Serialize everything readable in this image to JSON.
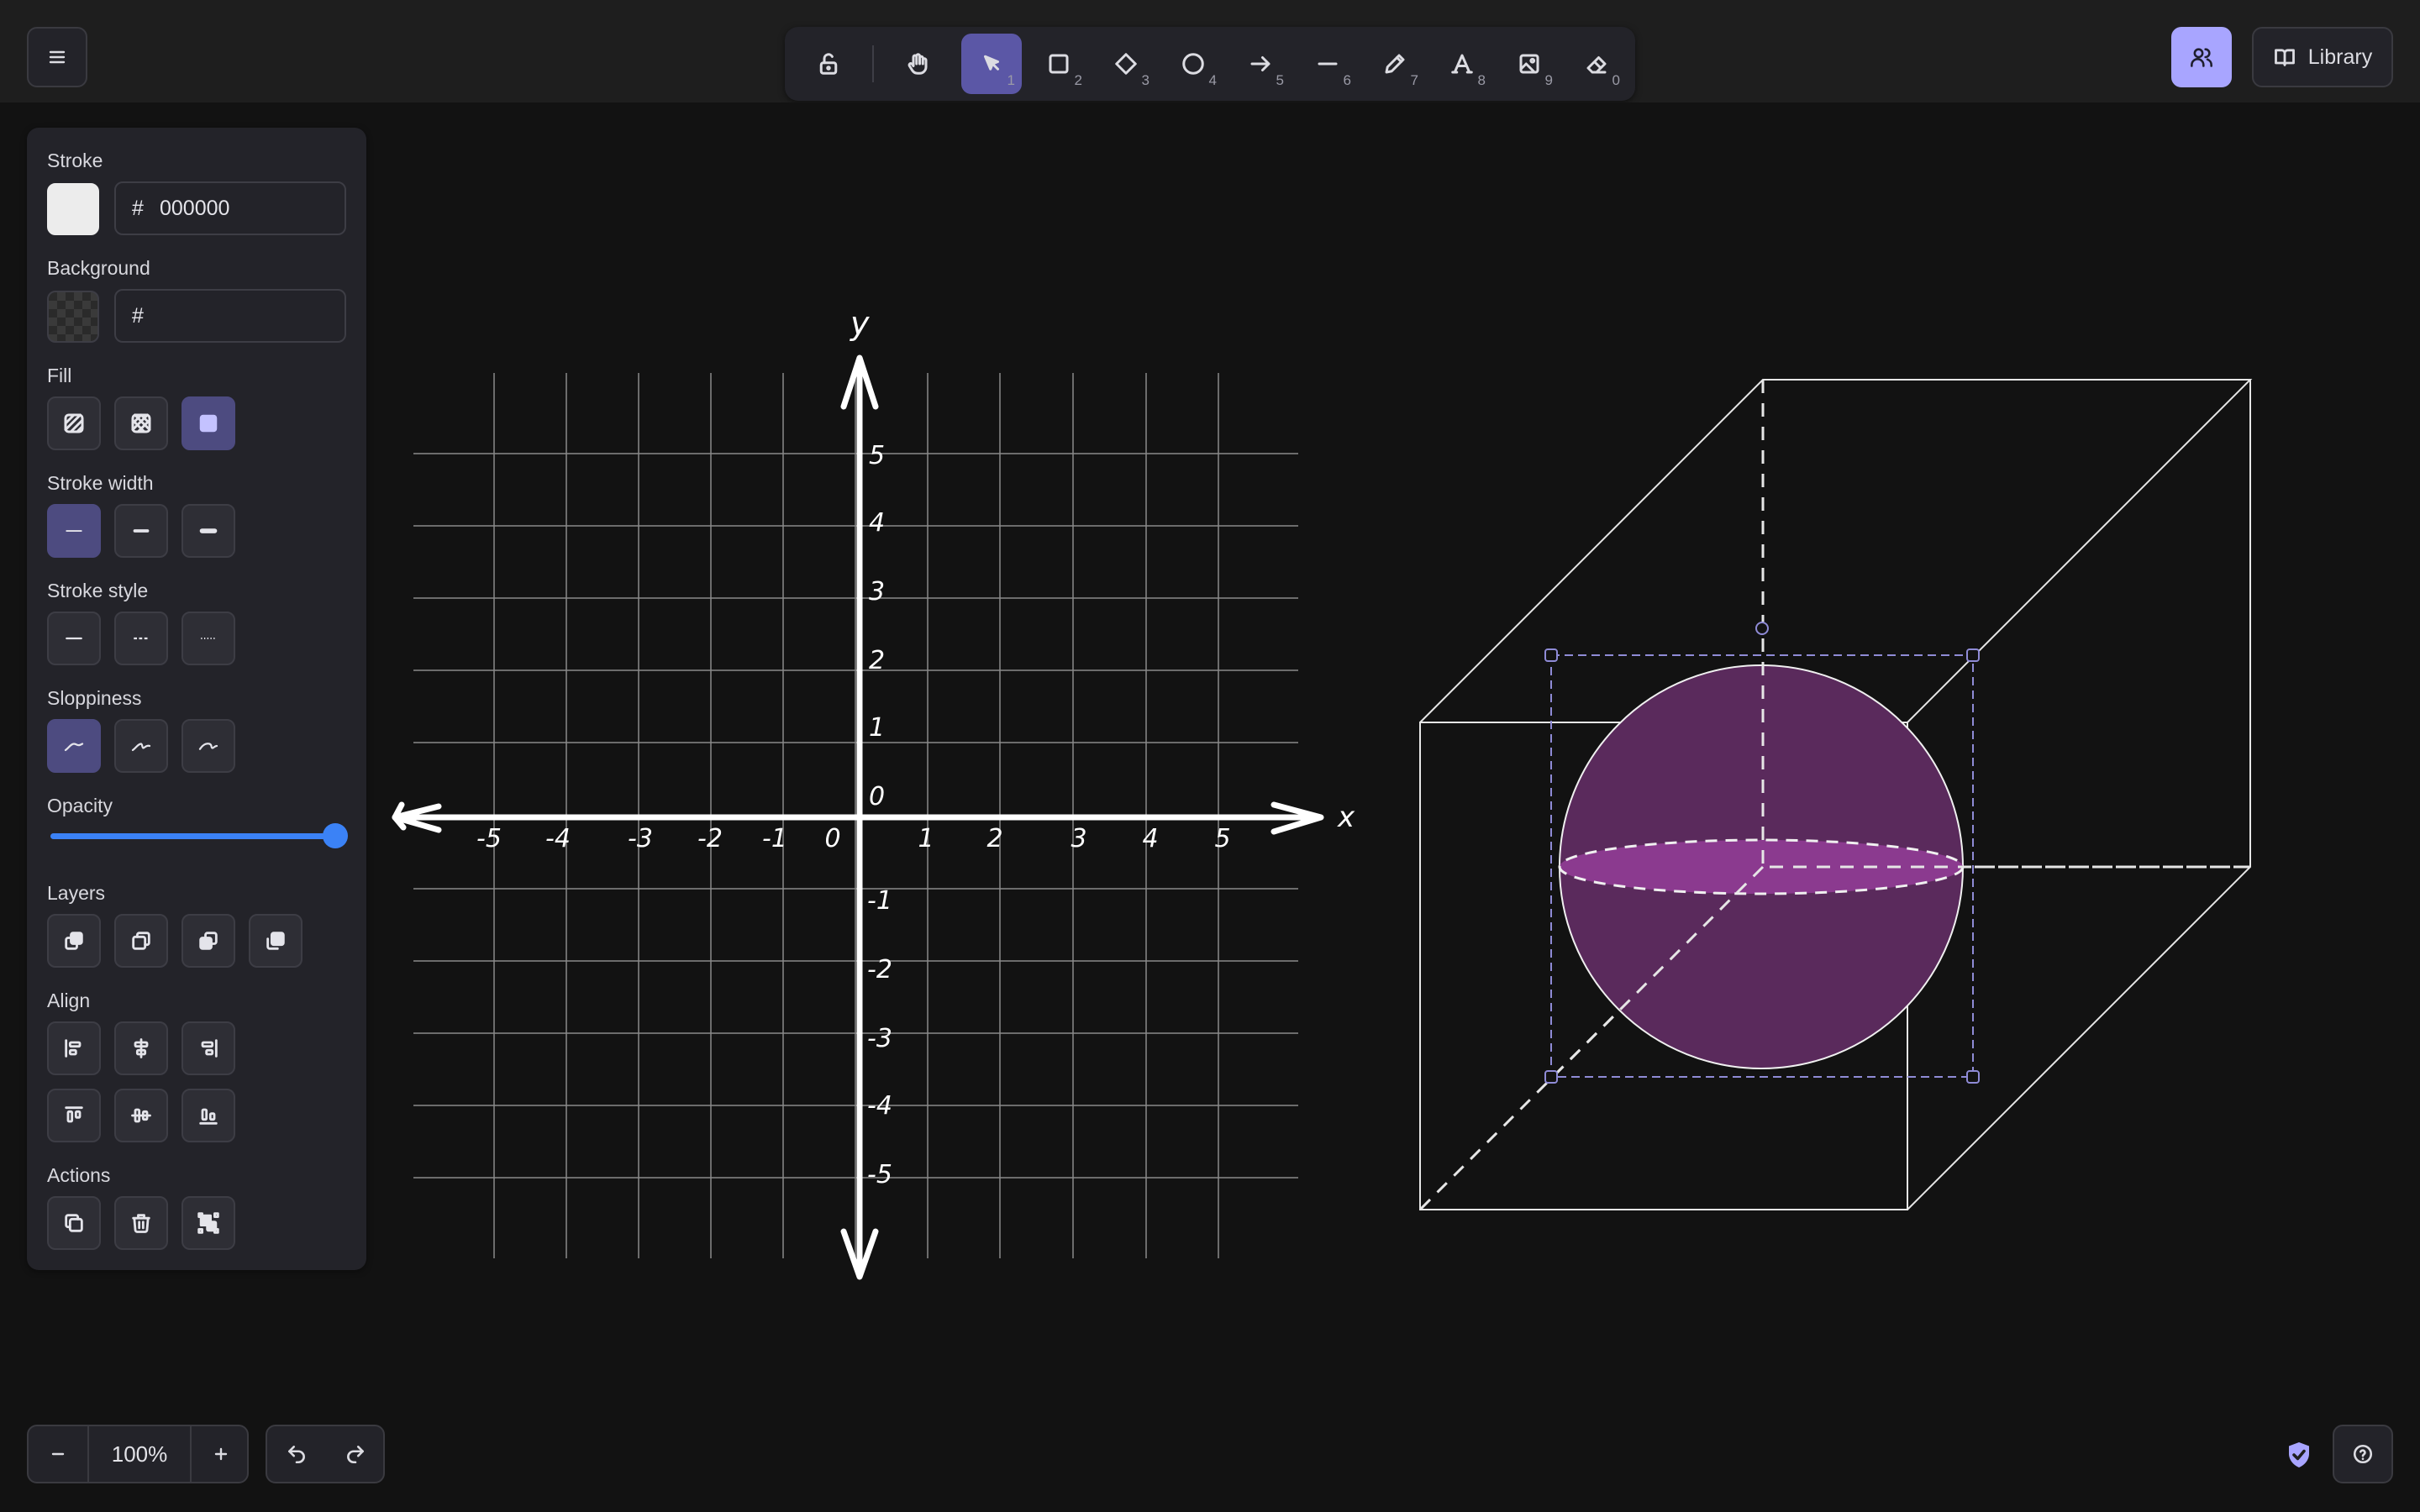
{
  "topbar": {
    "library_label": "Library",
    "tools": [
      {
        "name": "lock",
        "key": ""
      },
      {
        "name": "hand",
        "key": ""
      },
      {
        "name": "selection",
        "key": "1"
      },
      {
        "name": "rectangle",
        "key": "2"
      },
      {
        "name": "diamond",
        "key": "3"
      },
      {
        "name": "ellipse",
        "key": "4"
      },
      {
        "name": "arrow",
        "key": "5"
      },
      {
        "name": "line",
        "key": "6"
      },
      {
        "name": "draw",
        "key": "7"
      },
      {
        "name": "text",
        "key": "8"
      },
      {
        "name": "image",
        "key": "9"
      },
      {
        "name": "eraser",
        "key": "0"
      }
    ],
    "active_tool": "selection"
  },
  "panel": {
    "stroke_label": "Stroke",
    "stroke_hex": "000000",
    "background_label": "Background",
    "background_hex": "",
    "hash": "#",
    "fill_label": "Fill",
    "stroke_width_label": "Stroke width",
    "stroke_style_label": "Stroke style",
    "sloppiness_label": "Sloppiness",
    "opacity_label": "Opacity",
    "opacity_value": 100,
    "layers_label": "Layers",
    "align_label": "Align",
    "actions_label": "Actions"
  },
  "footer": {
    "zoom_label": "100%"
  },
  "canvas": {
    "graph": {
      "x_axis_label": "x",
      "y_axis_label": "y",
      "x_ticks": [
        "-5",
        "-4",
        "-3",
        "-2",
        "-1",
        "0",
        "1",
        "2",
        "3",
        "4",
        "5"
      ],
      "y_ticks_pos": [
        "5",
        "4",
        "3",
        "2",
        "1",
        "0"
      ],
      "y_ticks_neg": [
        "-1",
        "-2",
        "-3",
        "-4",
        "-5"
      ]
    },
    "colors": {
      "sphere_fill": "#5a2a5c",
      "sphere_band": "#8b3a8f",
      "selection": "#8f8bd6",
      "accent": "#a8a5ff"
    }
  }
}
